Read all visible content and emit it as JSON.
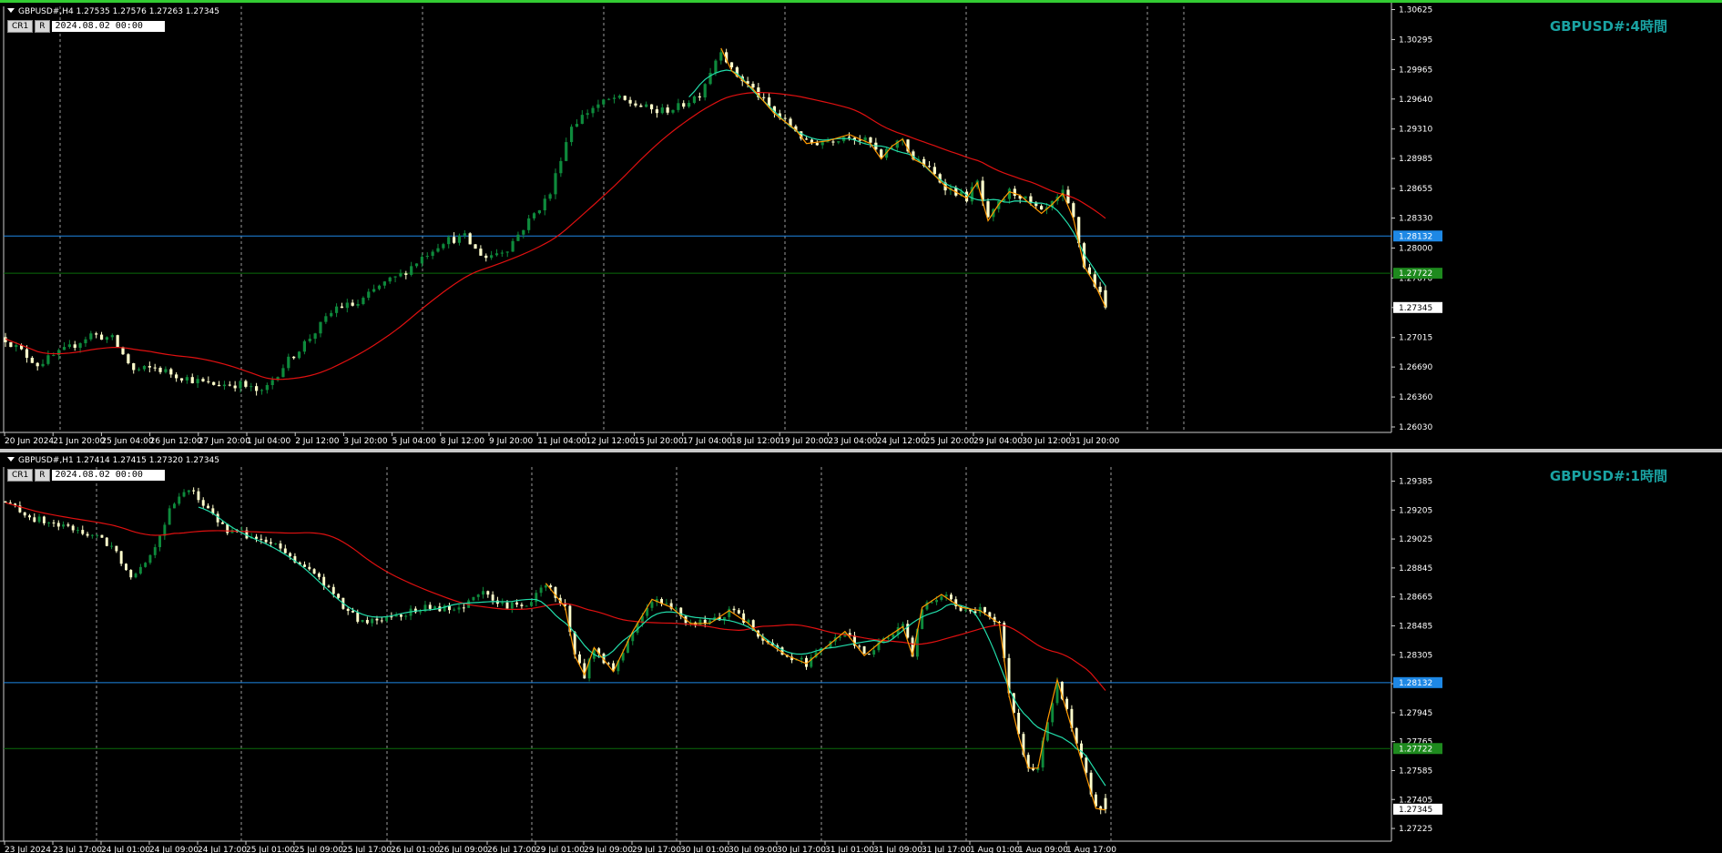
{
  "colors": {
    "up": "#0e8a3c",
    "down": "#ffffcc",
    "ma": "#e01010",
    "zigzag": "#ff9900",
    "smooth": "#22ddaa",
    "blue_line": "#1e88e5",
    "green_line": "#0a6b0a",
    "grid": "#9a9a9a",
    "axis_text": "#ffffff",
    "title": "#1aa3a3"
  },
  "h4": {
    "header": "GBPUSD#,H4  1.27535 1.27576 1.27263 1.27345",
    "cr_label": "CR1",
    "r_label": "R",
    "date_input": "2024.08.02 00:00",
    "title": "GBPUSD#:4時間",
    "price_labels": [
      "1.30625",
      "1.30295",
      "1.29965",
      "1.29640",
      "1.29310",
      "1.28985",
      "1.28655",
      "1.28330",
      "1.28000",
      "1.27670",
      "1.27345",
      "1.27015",
      "1.26690",
      "1.26360",
      "1.26030"
    ],
    "blue_level": "1.28132",
    "green_level": "1.27722",
    "current_price": "1.27345",
    "time_labels": [
      "20 Jun 2024",
      "21 Jun 20:00",
      "25 Jun 04:00",
      "26 Jun 12:00",
      "27 Jun 20:00",
      "1 Jul 04:00",
      "2 Jul 12:00",
      "3 Jul 20:00",
      "5 Jul 04:00",
      "8 Jul 12:00",
      "9 Jul 20:00",
      "11 Jul 04:00",
      "12 Jul 12:00",
      "15 Jul 20:00",
      "17 Jul 04:00",
      "18 Jul 12:00",
      "19 Jul 20:00",
      "23 Jul 04:00",
      "24 Jul 12:00",
      "25 Jul 20:00",
      "29 Jul 04:00",
      "30 Jul 12:00",
      "31 Jul 20:00"
    ]
  },
  "h1": {
    "header": "GBPUSD#,H1  1.27414 1.27415 1.27320 1.27345",
    "cr_label": "CR1",
    "r_label": "R",
    "date_input": "2024.08.02 00:00",
    "title": "GBPUSD#:1時間",
    "price_labels": [
      "1.29385",
      "1.29205",
      "1.29025",
      "1.28845",
      "1.28665",
      "1.28485",
      "1.28305",
      "1.28125",
      "1.27945",
      "1.27765",
      "1.27585",
      "1.27405",
      "1.27225"
    ],
    "blue_level": "1.28132",
    "green_level": "1.27722",
    "current_price": "1.27345",
    "time_labels": [
      "23 Jul 2024",
      "23 Jul 17:00",
      "24 Jul 01:00",
      "24 Jul 09:00",
      "24 Jul 17:00",
      "25 Jul 01:00",
      "25 Jul 09:00",
      "25 Jul 17:00",
      "26 Jul 01:00",
      "26 Jul 09:00",
      "26 Jul 17:00",
      "29 Jul 01:00",
      "29 Jul 09:00",
      "29 Jul 17:00",
      "30 Jul 01:00",
      "30 Jul 09:00",
      "30 Jul 17:00",
      "31 Jul 01:00",
      "31 Jul 09:00",
      "31 Jul 17:00",
      "1 Aug 01:00",
      "1 Aug 09:00",
      "1 Aug 17:00"
    ]
  },
  "chart_data": [
    {
      "type": "candlestick",
      "title": "GBPUSD#:4時間",
      "timeframe": "H4",
      "close_path": [
        [
          0,
          1.27
        ],
        [
          6,
          1.2672
        ],
        [
          12,
          1.269
        ],
        [
          16,
          1.2705
        ],
        [
          20,
          1.27
        ],
        [
          24,
          1.2665
        ],
        [
          28,
          1.2668
        ],
        [
          32,
          1.266
        ],
        [
          38,
          1.265
        ],
        [
          44,
          1.265
        ],
        [
          48,
          1.264
        ],
        [
          52,
          1.267
        ],
        [
          58,
          1.2708
        ],
        [
          62,
          1.2735
        ],
        [
          66,
          1.2738
        ],
        [
          70,
          1.2758
        ],
        [
          74,
          1.277
        ],
        [
          78,
          1.279
        ],
        [
          82,
          1.2808
        ],
        [
          86,
          1.2812
        ],
        [
          88,
          1.2798
        ],
        [
          90,
          1.279
        ],
        [
          94,
          1.28
        ],
        [
          98,
          1.283
        ],
        [
          102,
          1.286
        ],
        [
          104,
          1.29
        ],
        [
          106,
          1.2935
        ],
        [
          110,
          1.2955
        ],
        [
          114,
          1.2965
        ],
        [
          118,
          1.2958
        ],
        [
          122,
          1.295
        ],
        [
          126,
          1.2955
        ],
        [
          130,
          1.297
        ],
        [
          134,
          1.302
        ],
        [
          136,
          1.2995
        ],
        [
          140,
          1.2975
        ],
        [
          144,
          1.2948
        ],
        [
          148,
          1.293
        ],
        [
          150,
          1.2915
        ],
        [
          154,
          1.2918
        ],
        [
          158,
          1.2925
        ],
        [
          162,
          1.2915
        ],
        [
          164,
          1.2898
        ],
        [
          166,
          1.2912
        ],
        [
          168,
          1.292
        ],
        [
          170,
          1.2898
        ],
        [
          172,
          1.2892
        ],
        [
          176,
          1.2868
        ],
        [
          180,
          1.2855
        ],
        [
          182,
          1.2872
        ],
        [
          184,
          1.283
        ],
        [
          186,
          1.2848
        ],
        [
          188,
          1.2862
        ],
        [
          190,
          1.2858
        ],
        [
          192,
          1.2848
        ],
        [
          194,
          1.2838
        ],
        [
          196,
          1.2848
        ],
        [
          198,
          1.286
        ],
        [
          200,
          1.2832
        ],
        [
          202,
          1.278
        ],
        [
          204,
          1.276
        ],
        [
          206,
          1.2735
        ]
      ],
      "last_ohlc": {
        "open": 1.27535,
        "high": 1.27576,
        "low": 1.27263,
        "close": 1.27345
      },
      "levels": [
        1.28132,
        1.27722
      ],
      "ylim": [
        1.2603,
        1.3062
      ]
    },
    {
      "type": "candlestick",
      "title": "GBPUSD#:1時間",
      "timeframe": "H1",
      "close_path": [
        [
          0,
          1.2925
        ],
        [
          6,
          1.2915
        ],
        [
          12,
          1.291
        ],
        [
          18,
          1.2905
        ],
        [
          22,
          1.2898
        ],
        [
          26,
          1.288
        ],
        [
          30,
          1.2892
        ],
        [
          34,
          1.292
        ],
        [
          38,
          1.2935
        ],
        [
          42,
          1.292
        ],
        [
          46,
          1.2908
        ],
        [
          50,
          1.2905
        ],
        [
          56,
          1.2898
        ],
        [
          62,
          1.2885
        ],
        [
          66,
          1.2875
        ],
        [
          70,
          1.286
        ],
        [
          74,
          1.285
        ],
        [
          80,
          1.2855
        ],
        [
          88,
          1.286
        ],
        [
          94,
          1.2858
        ],
        [
          98,
          1.287
        ],
        [
          102,
          1.2862
        ],
        [
          108,
          1.286
        ],
        [
          112,
          1.2875
        ],
        [
          116,
          1.286
        ],
        [
          118,
          1.283
        ],
        [
          120,
          1.2818
        ],
        [
          122,
          1.2835
        ],
        [
          126,
          1.282
        ],
        [
          130,
          1.2845
        ],
        [
          134,
          1.2865
        ],
        [
          138,
          1.286
        ],
        [
          142,
          1.285
        ],
        [
          146,
          1.285
        ],
        [
          150,
          1.2858
        ],
        [
          154,
          1.285
        ],
        [
          158,
          1.2838
        ],
        [
          162,
          1.283
        ],
        [
          166,
          1.2825
        ],
        [
          170,
          1.2835
        ],
        [
          174,
          1.2845
        ],
        [
          178,
          1.283
        ],
        [
          182,
          1.284
        ],
        [
          186,
          1.2848
        ],
        [
          188,
          1.283
        ],
        [
          190,
          1.286
        ],
        [
          194,
          1.2868
        ],
        [
          198,
          1.286
        ],
        [
          202,
          1.2858
        ],
        [
          206,
          1.285
        ],
        [
          208,
          1.2805
        ],
        [
          210,
          1.278
        ],
        [
          212,
          1.276
        ],
        [
          214,
          1.276
        ],
        [
          216,
          1.279
        ],
        [
          218,
          1.2815
        ],
        [
          220,
          1.2795
        ],
        [
          222,
          1.2775
        ],
        [
          224,
          1.2755
        ],
        [
          226,
          1.2735
        ],
        [
          228,
          1.2734
        ]
      ],
      "last_ohlc": {
        "open": 1.27414,
        "high": 1.27415,
        "low": 1.2732,
        "close": 1.27345
      },
      "levels": [
        1.28132,
        1.27722
      ],
      "ylim": [
        1.2718,
        1.2945
      ]
    }
  ]
}
